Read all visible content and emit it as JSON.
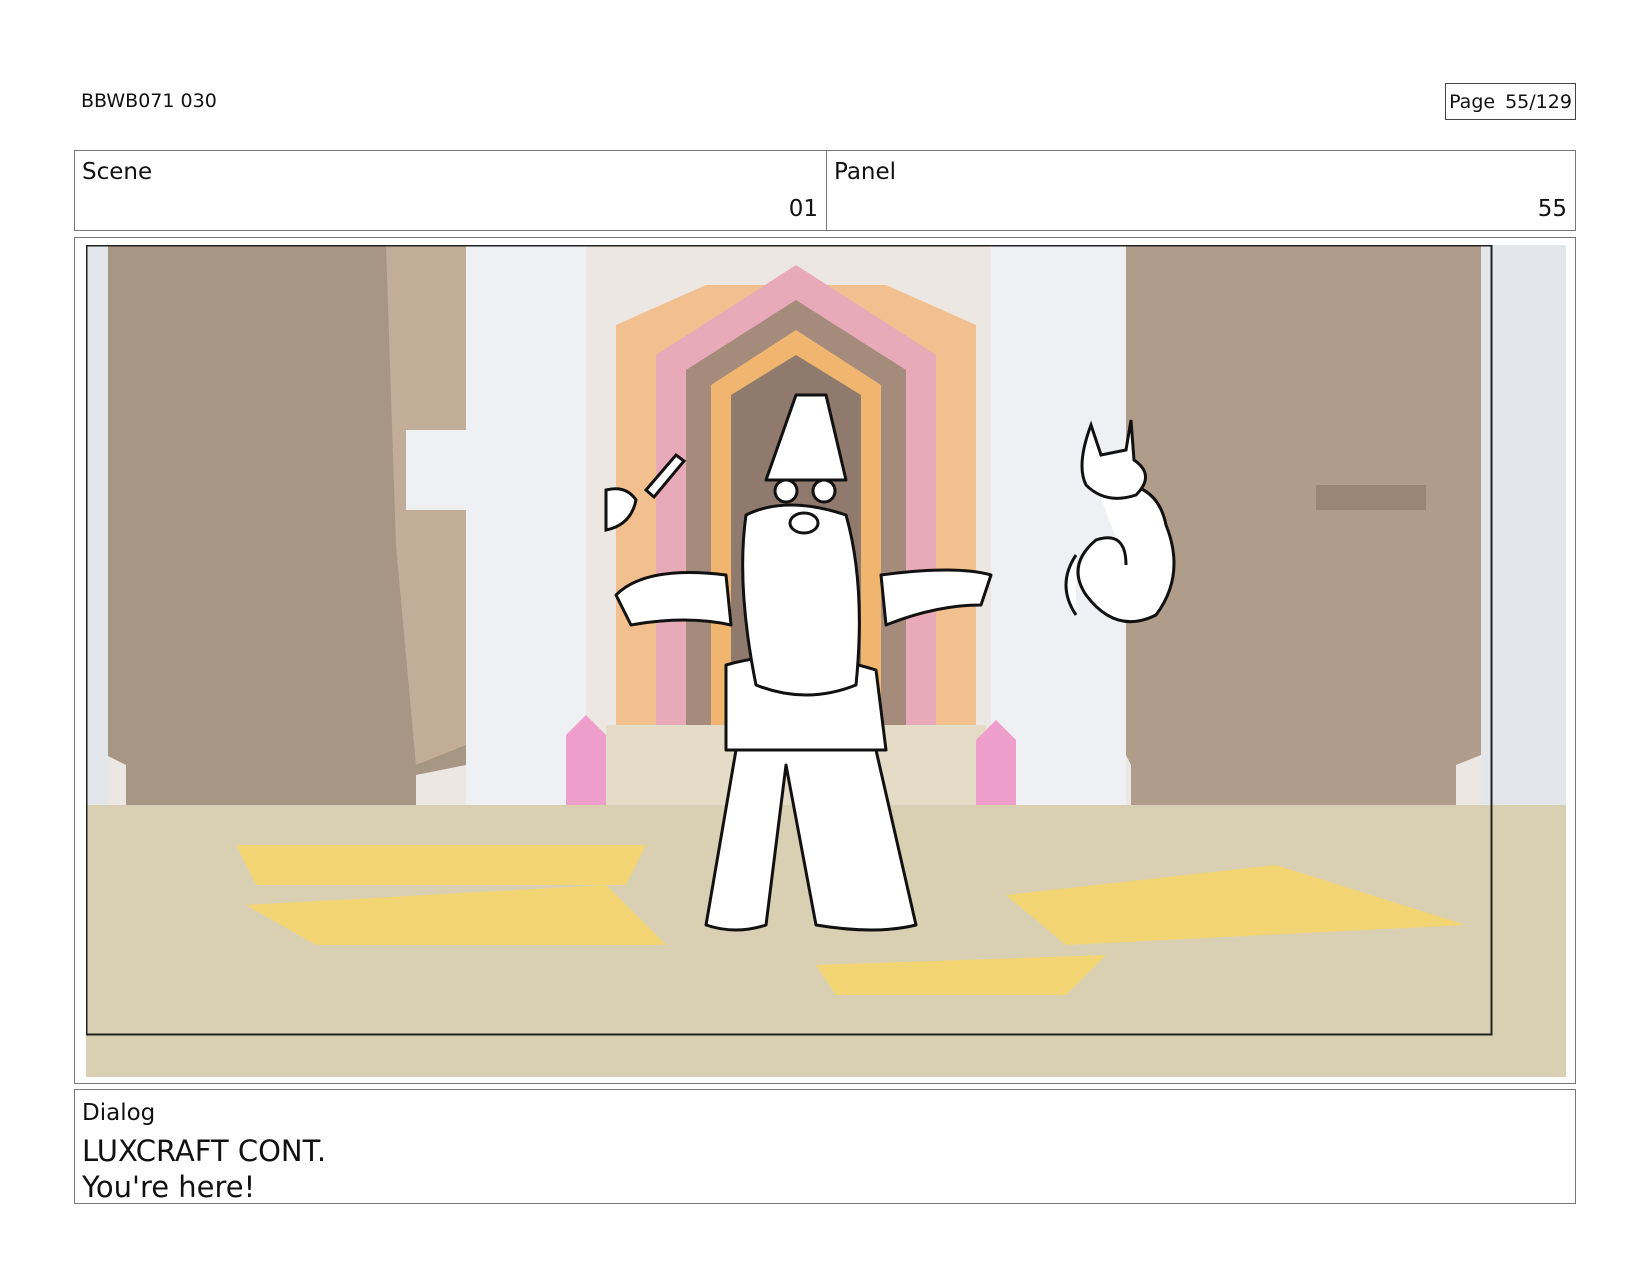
{
  "header": {
    "doc_id": "BBWB071 030",
    "page_label": "Page",
    "page_number": "55/129"
  },
  "info": {
    "scene_label": "Scene",
    "scene_value": "01",
    "panel_label": "Panel",
    "panel_value": "55"
  },
  "dialog": {
    "label": "Dialog",
    "speaker": "LUXCRAFT CONT.",
    "line": "You're here!"
  },
  "colors": {
    "border": "#777777",
    "floor": "#d8cfb2",
    "floor_tile": "#f2d06a",
    "rock": "#b59e8b",
    "pillar": "#e8eaee",
    "crystal": "#ec9ec8",
    "door_pink": "#e6a4b6",
    "door_orange": "#f2b46e",
    "door_brown": "#9e8576"
  }
}
